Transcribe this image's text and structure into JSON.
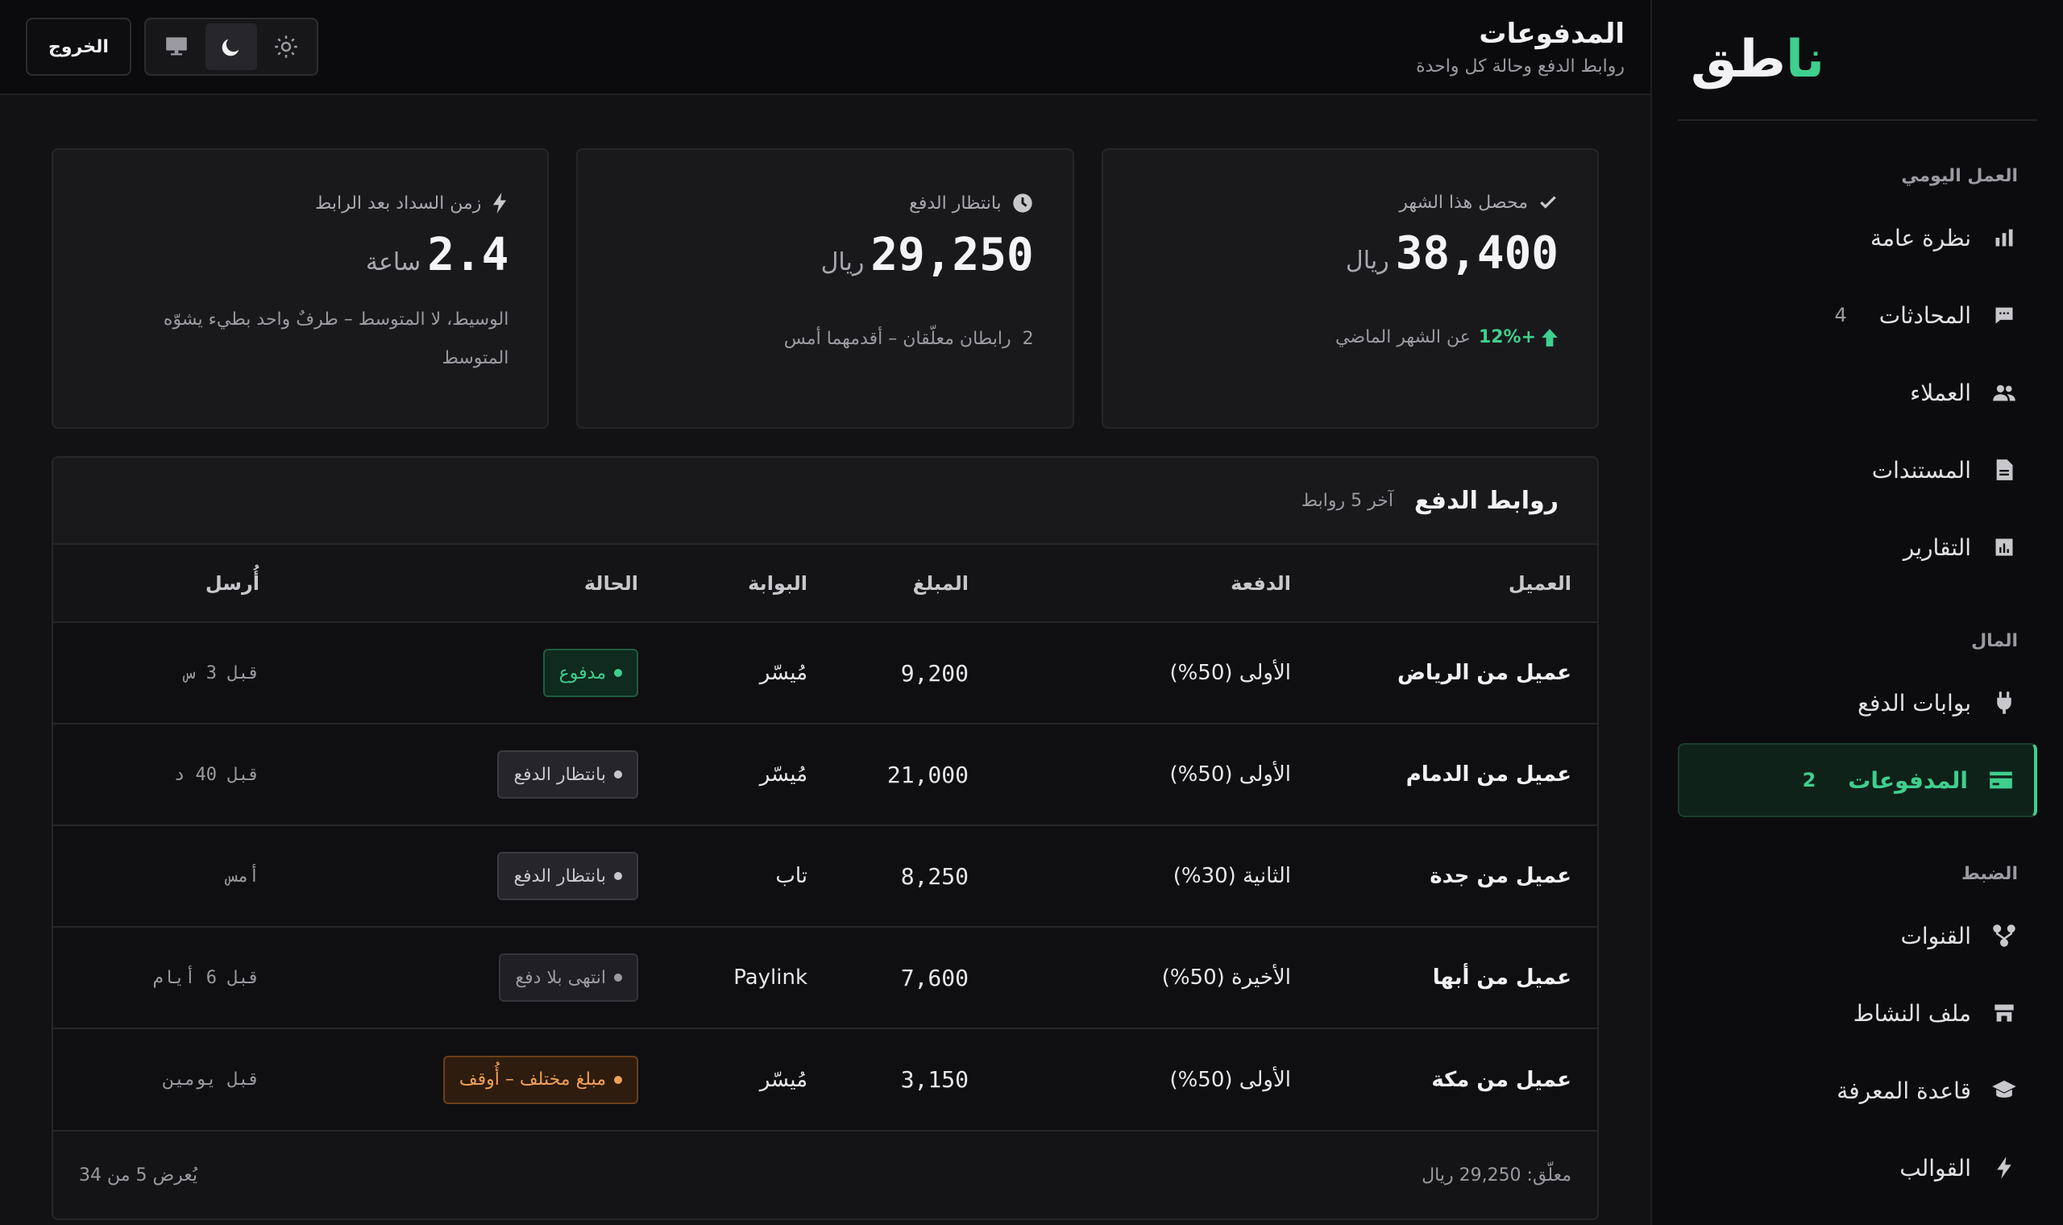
{
  "sidebar": {
    "logo": {
      "accent": "نا",
      "rest": "طق"
    },
    "sections": [
      {
        "title": "العمل اليومي",
        "items": [
          {
            "label": "نظرة عامة",
            "icon": "bar-chart-icon",
            "count": ""
          },
          {
            "label": "المحادثات",
            "icon": "chat-icon",
            "count": "4"
          },
          {
            "label": "العملاء",
            "icon": "users-icon",
            "count": ""
          },
          {
            "label": "المستندات",
            "icon": "document-icon",
            "count": ""
          },
          {
            "label": "التقارير",
            "icon": "report-icon",
            "count": ""
          }
        ]
      },
      {
        "title": "المال",
        "items": [
          {
            "label": "بوابات الدفع",
            "icon": "plug-icon",
            "count": ""
          },
          {
            "label": "المدفوعات",
            "icon": "card-icon",
            "count": "2",
            "active": true
          }
        ]
      },
      {
        "title": "الضبط",
        "items": [
          {
            "label": "القنوات",
            "icon": "channels-icon",
            "count": ""
          },
          {
            "label": "ملف النشاط",
            "icon": "store-icon",
            "count": ""
          },
          {
            "label": "قاعدة المعرفة",
            "icon": "graduation-cap-icon",
            "count": ""
          },
          {
            "label": "القوالب",
            "icon": "bolt-icon",
            "count": ""
          }
        ]
      }
    ]
  },
  "header": {
    "title": "المدفوعات",
    "subtitle": "روابط الدفع وحالة كل واحدة",
    "logout": "الخروج",
    "theme_options": [
      "sun-icon",
      "moon-icon",
      "monitor-icon"
    ],
    "theme_selected": "moon-icon"
  },
  "stats": [
    {
      "label": "محصل هذا الشهر",
      "icon": "check-icon",
      "value": "38,400",
      "unit": "ريال",
      "trend": "+12%",
      "foot": "عن الشهر الماضي"
    },
    {
      "label": "بانتظار الدفع",
      "icon": "clock-icon",
      "value": "29,250",
      "unit": "ريال",
      "foot_num": "2",
      "foot": "رابطان معلّقان – أقدمهما أمس"
    },
    {
      "label": "زمن السداد بعد الرابط",
      "icon": "bolt-icon",
      "value": "2.4",
      "unit": "ساعة",
      "foot": "الوسيط، لا المتوسط – طرفٌ واحد بطيء يشوّه المتوسط"
    }
  ],
  "table": {
    "title": "روابط الدفع",
    "subtitle": "آخر 5 روابط",
    "columns": {
      "client": "العميل",
      "batch": "الدفعة",
      "amount": "المبلغ",
      "gateway": "البوابة",
      "status": "الحالة",
      "sent": "أُرسل"
    },
    "rows": [
      {
        "client": "عميل من الرياض",
        "batch": "الأولى (50%)",
        "amount": "9,200",
        "gateway": "مُيسّر",
        "status": "مدفوع",
        "status_kind": "paid",
        "sent": "قبل 3 س"
      },
      {
        "client": "عميل من الدمام",
        "batch": "الأولى (50%)",
        "amount": "21,000",
        "gateway": "مُيسّر",
        "status": "بانتظار الدفع",
        "status_kind": "pending",
        "sent": "قبل 40 د"
      },
      {
        "client": "عميل من جدة",
        "batch": "الثانية (30%)",
        "amount": "8,250",
        "gateway": "تاب",
        "status": "بانتظار الدفع",
        "status_kind": "pending",
        "sent": "أمس"
      },
      {
        "client": "عميل من أبها",
        "batch": "الأخيرة (50%)",
        "amount": "7,600",
        "gateway": "Paylink",
        "status": "انتهى بلا دفع",
        "status_kind": "expired",
        "sent": "قبل 6 أيام"
      },
      {
        "client": "عميل من مكة",
        "batch": "الأولى (50%)",
        "amount": "3,150",
        "gateway": "مُيسّر",
        "status": "مبلغ مختلف – أُوقف",
        "status_kind": "warn",
        "sent": "قبل يومين"
      }
    ],
    "footer_pending": "معلّق: 29,250 ريال",
    "footer_count": "يُعرض 5 من 34"
  },
  "colors": {
    "accent": "#3fcf8e",
    "background": "#121214",
    "warning": "#f0a057"
  }
}
